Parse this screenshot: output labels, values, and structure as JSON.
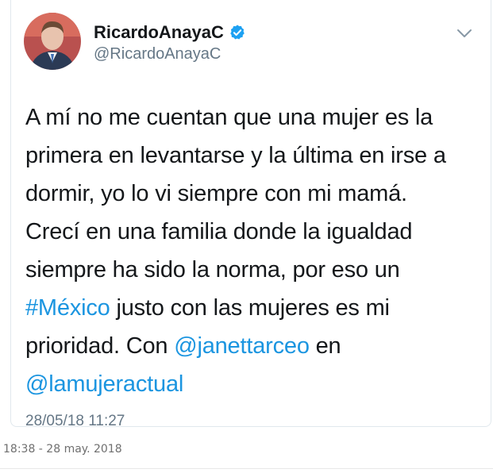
{
  "user": {
    "display_name": "RicardoAnayaC",
    "handle": "@RicardoAnayaC"
  },
  "tweet": {
    "text_lines": [
      [
        {
          "t": "A mí no me cuentan que una mujer es la"
        }
      ],
      [
        {
          "t": "primera en levantarse y la última en irse a"
        }
      ],
      [
        {
          "t": "dormir, yo lo vi siempre con mi mamá."
        }
      ],
      [
        {
          "t": "Crecí en una familia donde la igualdad"
        }
      ],
      [
        {
          "t": "siempre ha sido la norma, por eso un"
        }
      ],
      [
        {
          "t": "#México",
          "link": true
        },
        {
          "t": " justo con las mujeres es mi"
        }
      ],
      [
        {
          "t": "prioridad. Con "
        },
        {
          "t": "@janettarceo",
          "link": true
        },
        {
          "t": " en"
        }
      ],
      [
        {
          "t": "@lamujeractual",
          "link": true
        }
      ]
    ],
    "timestamp": "28/05/18 11:27"
  },
  "post_date": "18:38 - 28 may. 2018",
  "icons": {
    "verified": "verified-icon",
    "menu": "chevron-down-icon"
  },
  "colors": {
    "link": "#1b95e0",
    "verified": "#1da1f2",
    "secondary_text": "#657786"
  }
}
